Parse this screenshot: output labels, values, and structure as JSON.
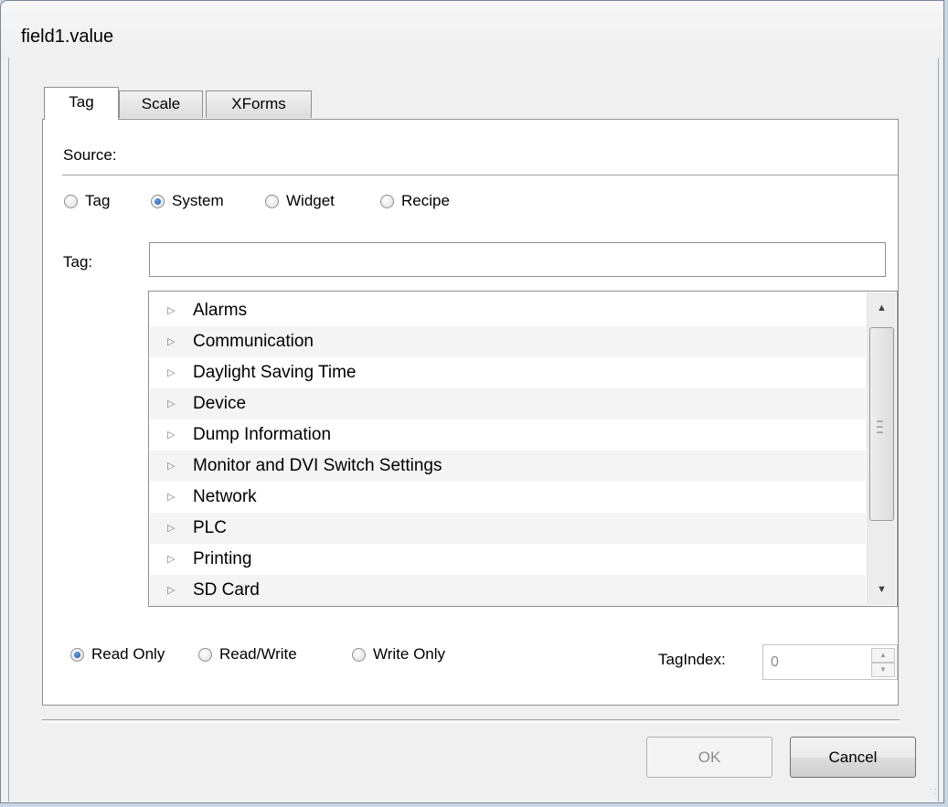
{
  "window": {
    "title": "field1.value"
  },
  "tabs": [
    {
      "label": "Tag",
      "active": true
    },
    {
      "label": "Scale",
      "active": false
    },
    {
      "label": "XForms",
      "active": false
    }
  ],
  "source": {
    "label": "Source:",
    "options": [
      {
        "label": "Tag",
        "checked": false
      },
      {
        "label": "System",
        "checked": true
      },
      {
        "label": "Widget",
        "checked": false
      },
      {
        "label": "Recipe",
        "checked": false
      }
    ]
  },
  "tag_field": {
    "label": "Tag:",
    "value": ""
  },
  "tree": {
    "items": [
      {
        "label": "Alarms"
      },
      {
        "label": "Communication"
      },
      {
        "label": "Daylight Saving Time"
      },
      {
        "label": "Device"
      },
      {
        "label": "Dump Information"
      },
      {
        "label": "Monitor and DVI Switch Settings"
      },
      {
        "label": "Network"
      },
      {
        "label": "PLC"
      },
      {
        "label": "Printing"
      },
      {
        "label": "SD Card"
      }
    ],
    "expand_icon": "triangle-right-icon"
  },
  "access": {
    "options": [
      {
        "label": "Read Only",
        "checked": true
      },
      {
        "label": "Read/Write",
        "checked": false
      },
      {
        "label": "Write Only",
        "checked": false
      }
    ]
  },
  "tag_index": {
    "label": "TagIndex:",
    "value": "0",
    "disabled": true
  },
  "buttons": {
    "ok_label": "OK",
    "ok_disabled": true,
    "cancel_label": "Cancel"
  },
  "colors": {
    "radio_checked": "#1b4f9c",
    "panel_bg": "#ffffff",
    "window_bg": "#f0f0f0"
  }
}
